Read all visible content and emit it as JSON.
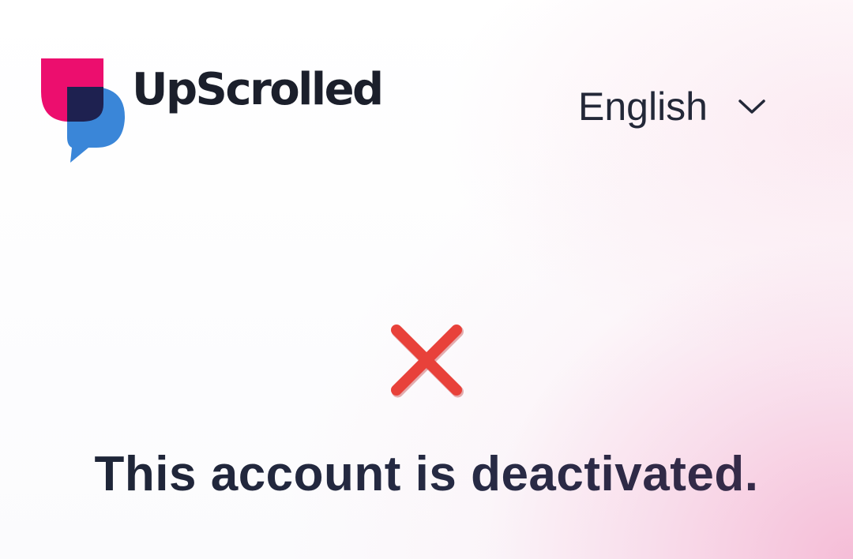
{
  "brand": {
    "name": "UpScrolled",
    "colors": {
      "pink": "#ec0e6e",
      "navy": "#1b1f3a",
      "blue": "#3a86d8",
      "text": "#1b1f2b"
    }
  },
  "language_selector": {
    "selected": "English",
    "icon": "chevron-down-icon"
  },
  "status": {
    "icon": "red-cross-icon",
    "icon_color": "#e53935",
    "message": "This account is deactivated."
  }
}
